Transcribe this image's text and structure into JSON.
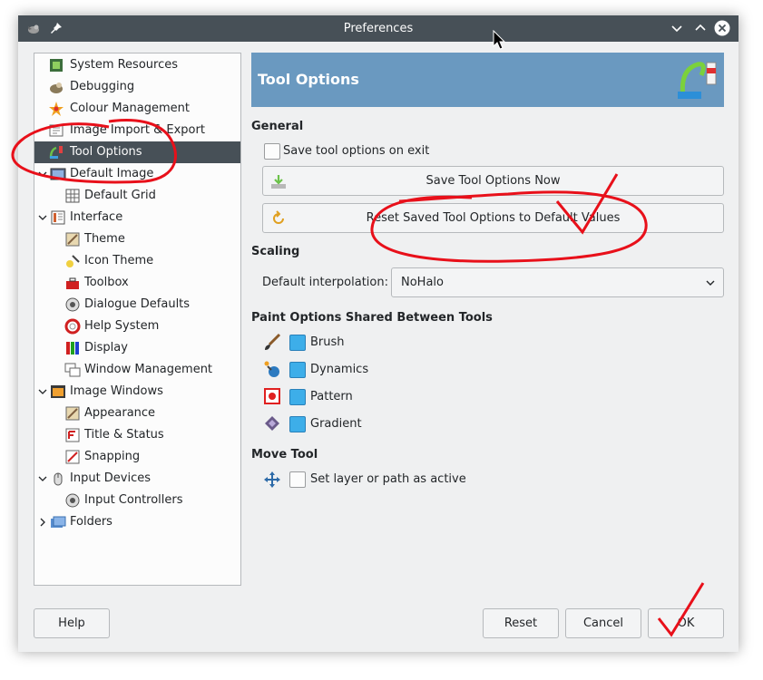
{
  "window": {
    "title": "Preferences"
  },
  "sidebar": {
    "items": [
      {
        "label": "System Resources"
      },
      {
        "label": "Debugging"
      },
      {
        "label": "Colour Management"
      },
      {
        "label": "Image Import & Export"
      },
      {
        "label": "Tool Options",
        "selected": true
      },
      {
        "label": "Default Image"
      },
      {
        "label": "Default Grid"
      },
      {
        "label": "Interface"
      },
      {
        "label": "Theme"
      },
      {
        "label": "Icon Theme"
      },
      {
        "label": "Toolbox"
      },
      {
        "label": "Dialogue Defaults"
      },
      {
        "label": "Help System"
      },
      {
        "label": "Display"
      },
      {
        "label": "Window Management"
      },
      {
        "label": "Image Windows"
      },
      {
        "label": "Appearance"
      },
      {
        "label": "Title & Status"
      },
      {
        "label": "Snapping"
      },
      {
        "label": "Input Devices"
      },
      {
        "label": "Input Controllers"
      },
      {
        "label": "Folders"
      }
    ]
  },
  "content": {
    "banner_title": "Tool Options",
    "general": {
      "heading": "General",
      "save_on_exit_label": "Save tool options on exit",
      "save_on_exit_checked": false,
      "save_now_label": "Save Tool Options Now",
      "reset_label": "Reset Saved Tool Options to Default Values"
    },
    "scaling": {
      "heading": "Scaling",
      "interp_label": "Default interpolation:",
      "interp_value": "NoHalo"
    },
    "paint": {
      "heading": "Paint Options Shared Between Tools",
      "items": [
        {
          "label": "Brush",
          "checked": true
        },
        {
          "label": "Dynamics",
          "checked": true
        },
        {
          "label": "Pattern",
          "checked": true
        },
        {
          "label": "Gradient",
          "checked": true
        }
      ]
    },
    "move": {
      "heading": "Move Tool",
      "active_label": "Set layer or path as active",
      "active_checked": false
    }
  },
  "footer": {
    "help_label": "Help",
    "reset_label": "Reset",
    "cancel_label": "Cancel",
    "ok_label": "OK"
  },
  "colors": {
    "titlebar": "#475057",
    "selection": "#475057",
    "banner": "#6a99c0",
    "checkbox_checked": "#3daee9",
    "annotation": "#e8101a"
  }
}
